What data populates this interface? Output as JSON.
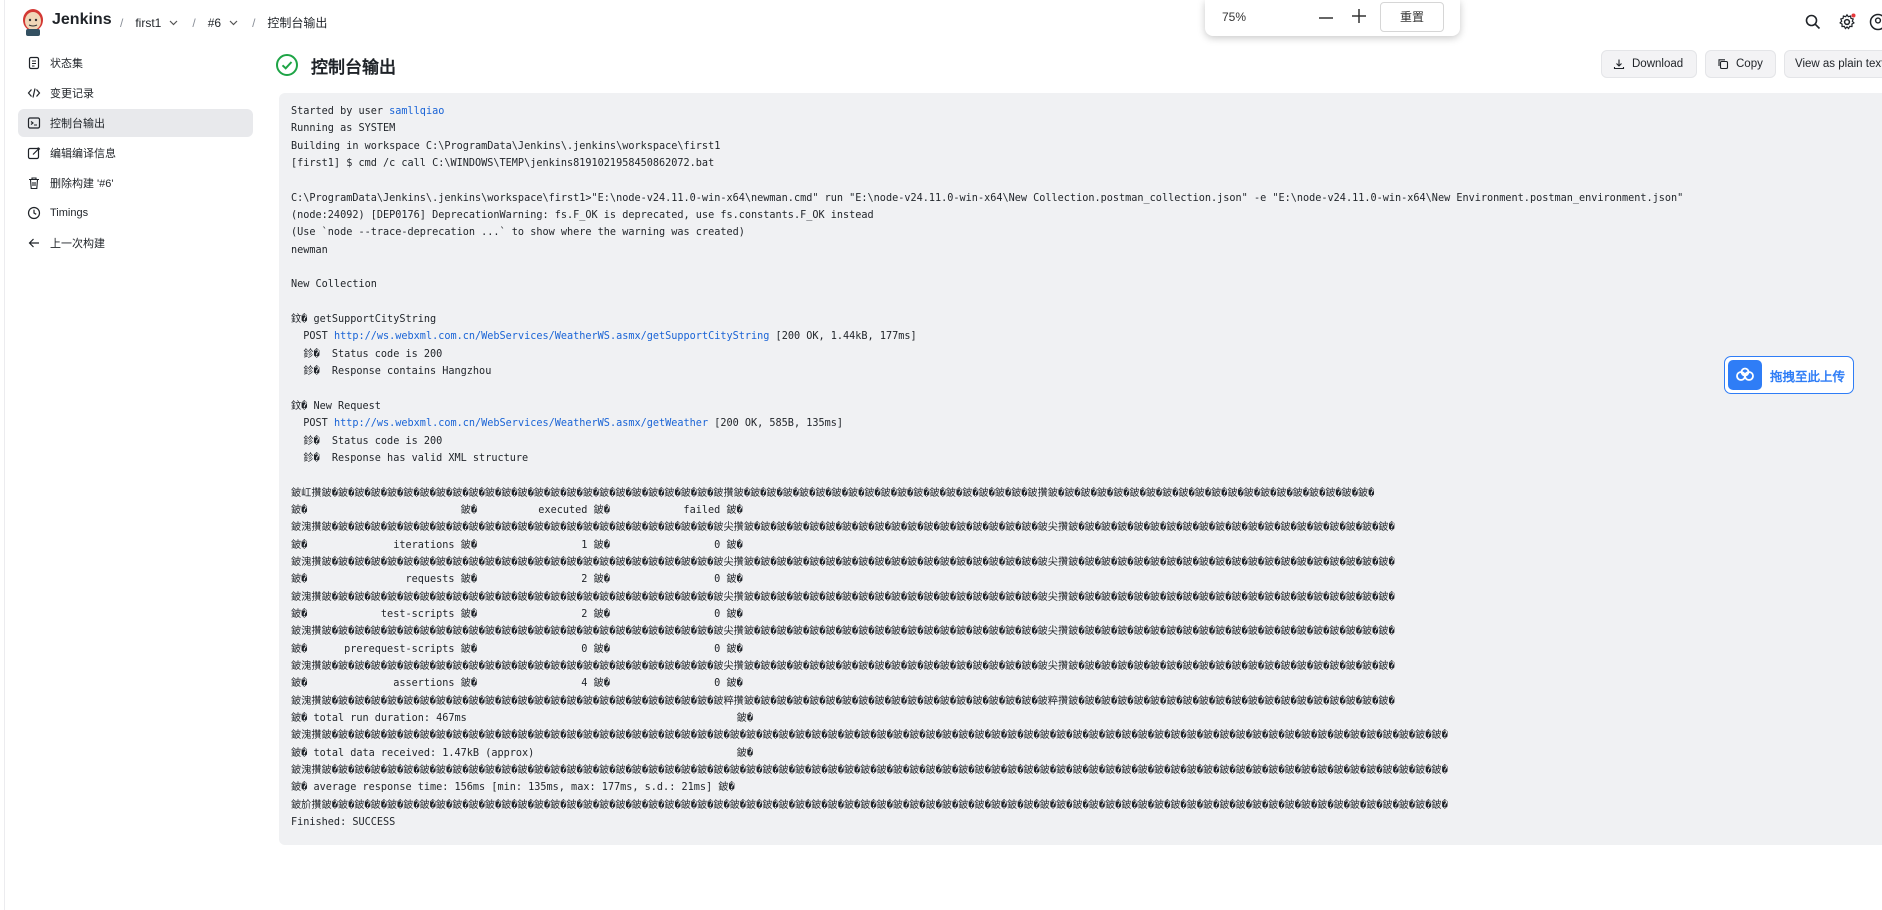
{
  "header": {
    "brand": "Jenkins",
    "breadcrumbs": [
      {
        "label": "first1",
        "has_dropdown": true
      },
      {
        "label": "#6",
        "has_dropdown": true
      },
      {
        "label": "控制台输出",
        "has_dropdown": false
      }
    ],
    "icons": [
      "search-icon",
      "settings-icon",
      "user-icon"
    ]
  },
  "zoom": {
    "level": "75%",
    "reset_label": "重置"
  },
  "sidebar": {
    "items": [
      {
        "label": "状态集",
        "icon": "document-icon",
        "active": false
      },
      {
        "label": "变更记录",
        "icon": "code-icon",
        "active": false
      },
      {
        "label": "控制台输出",
        "icon": "terminal-icon",
        "active": true
      },
      {
        "label": "编辑编译信息",
        "icon": "edit-icon",
        "active": false
      },
      {
        "label": "删除构建 '#6'",
        "icon": "trash-icon",
        "active": false
      },
      {
        "label": "Timings",
        "icon": "clock-icon",
        "active": false
      },
      {
        "label": "上一次构建",
        "icon": "arrow-left-icon",
        "active": false
      }
    ]
  },
  "main": {
    "title": "控制台输出",
    "status_color": "#1ea446",
    "actions": {
      "download": "Download",
      "copy": "Copy",
      "plain": "View as plain text"
    }
  },
  "console": {
    "l_started_prefix": "Started by user ",
    "l_started_user": "samllqiao",
    "l_running": "Running as SYSTEM",
    "l_building": "Building in workspace C:\\ProgramData\\Jenkins\\.jenkins\\workspace\\first1",
    "l_cmd": "[first1] $ cmd /c call C:\\WINDOWS\\TEMP\\jenkins8191021958450862072.bat",
    "l_blank1": "",
    "l_newman_cmd": "C:\\ProgramData\\Jenkins\\.jenkins\\workspace\\first1>\"E:\\node-v24.11.0-win-x64\\newman.cmd\" run \"E:\\node-v24.11.0-win-x64\\New Collection.postman_collection.json\" -e \"E:\\node-v24.11.0-win-x64\\New Environment.postman_environment.json\"",
    "l_deprecation": "(node:24092) [DEP0176] DeprecationWarning: fs.F_OK is deprecated, use fs.constants.F_OK instead",
    "l_trace": "(Use `node --trace-deprecation ...` to show where the warning was created)",
    "l_newman": "newman",
    "l_blank2": "",
    "l_collection": "New Collection",
    "l_blank3": "",
    "l_req1_name": "鈫� getSupportCityString",
    "l_req1_method": "  POST ",
    "l_req1_url": "http://ws.webxml.com.cn/WebServices/WeatherWS.asmx/getSupportCityString",
    "l_req1_stats": " [200 OK, 1.44kB, 177ms]",
    "l_req1_a1": "  鉁�  Status code is 200",
    "l_req1_a2": "  鉁�  Response contains Hangzhou",
    "l_blank4": "",
    "l_req2_name": "鈫� New Request",
    "l_req2_method": "  POST ",
    "l_req2_url": "http://ws.webxml.com.cn/WebServices/WeatherWS.asmx/getWeather",
    "l_req2_stats": " [200 OK, 585B, 135ms]",
    "l_req2_a1": "  鉁�  Status code is 200",
    "l_req2_a2": "  鉁�  Response has valid XML structure",
    "l_blank5": "",
    "l_t01": "鈹屸攢鈹�鈹�鈹�鈹�鈹�鈹�鈹�鈹�鈹�鈹�鈹�鈹�鈹�鈹�鈹�鈹�鈹�鈹�鈹�鈹�鈹�鈹�鈹�鈹�鈹攢鈹�鈹�鈹�鈹�鈹�鈹�鈹�鈹�鈹�鈹�鈹�鈹�鈹�鈹�鈹�鈹�鈹�鈹�鈹攢鈹�鈹�鈹�鈹�鈹�鈹�鈹�鈹�鈹�鈹�鈹�鈹�鈹�鈹�鈹�鈹�鈹�鈹�鈹�鈹�",
    "l_t02": "鈹�                         鈹�          executed 鈹�            failed 鈹�",
    "l_t03": "鈹溾攢鈹�鈹�鈹�鈹�鈹�鈹�鈹�鈹�鈹�鈹�鈹�鈹�鈹�鈹�鈹�鈹�鈹�鈹�鈹�鈹�鈹�鈹�鈹�鈹�鈹尖攢鈹�鈹�鈹�鈹�鈹�鈹�鈹�鈹�鈹�鈹�鈹�鈹�鈹�鈹�鈹�鈹�鈹�鈹�鈹尖攢鈹�鈹�鈹�鈹�鈹�鈹�鈹�鈹�鈹�鈹�鈹�鈹�鈹�鈹�鈹�鈹�鈹�鈹�鈹�鈹�",
    "l_t04": "鈹�              iterations 鈹�                 1 鈹�                 0 鈹�",
    "l_t05": "鈹溾攢鈹�鈹�鈹�鈹�鈹�鈹�鈹�鈹�鈹�鈹�鈹�鈹�鈹�鈹�鈹�鈹�鈹�鈹�鈹�鈹�鈹�鈹�鈹�鈹�鈹尖攢鈹�鈹�鈹�鈹�鈹�鈹�鈹�鈹�鈹�鈹�鈹�鈹�鈹�鈹�鈹�鈹�鈹�鈹�鈹尖攢鈹�鈹�鈹�鈹�鈹�鈹�鈹�鈹�鈹�鈹�鈹�鈹�鈹�鈹�鈹�鈹�鈹�鈹�鈹�鈹�",
    "l_t06": "鈹�                requests 鈹�                 2 鈹�                 0 鈹�",
    "l_t07": "鈹溾攢鈹�鈹�鈹�鈹�鈹�鈹�鈹�鈹�鈹�鈹�鈹�鈹�鈹�鈹�鈹�鈹�鈹�鈹�鈹�鈹�鈹�鈹�鈹�鈹�鈹尖攢鈹�鈹�鈹�鈹�鈹�鈹�鈹�鈹�鈹�鈹�鈹�鈹�鈹�鈹�鈹�鈹�鈹�鈹�鈹尖攢鈹�鈹�鈹�鈹�鈹�鈹�鈹�鈹�鈹�鈹�鈹�鈹�鈹�鈹�鈹�鈹�鈹�鈹�鈹�鈹�",
    "l_t08": "鈹�            test-scripts 鈹�                 2 鈹�                 0 鈹�",
    "l_t09": "鈹溾攢鈹�鈹�鈹�鈹�鈹�鈹�鈹�鈹�鈹�鈹�鈹�鈹�鈹�鈹�鈹�鈹�鈹�鈹�鈹�鈹�鈹�鈹�鈹�鈹�鈹尖攢鈹�鈹�鈹�鈹�鈹�鈹�鈹�鈹�鈹�鈹�鈹�鈹�鈹�鈹�鈹�鈹�鈹�鈹�鈹尖攢鈹�鈹�鈹�鈹�鈹�鈹�鈹�鈹�鈹�鈹�鈹�鈹�鈹�鈹�鈹�鈹�鈹�鈹�鈹�鈹�",
    "l_t10": "鈹�      prerequest-scripts 鈹�                 0 鈹�                 0 鈹�",
    "l_t11": "鈹溾攢鈹�鈹�鈹�鈹�鈹�鈹�鈹�鈹�鈹�鈹�鈹�鈹�鈹�鈹�鈹�鈹�鈹�鈹�鈹�鈹�鈹�鈹�鈹�鈹�鈹尖攢鈹�鈹�鈹�鈹�鈹�鈹�鈹�鈹�鈹�鈹�鈹�鈹�鈹�鈹�鈹�鈹�鈹�鈹�鈹尖攢鈹�鈹�鈹�鈹�鈹�鈹�鈹�鈹�鈹�鈹�鈹�鈹�鈹�鈹�鈹�鈹�鈹�鈹�鈹�鈹�",
    "l_t12": "鈹�              assertions 鈹�                 4 鈹�                 0 鈹�",
    "l_t13": "鈹溾攢鈹�鈹�鈹�鈹�鈹�鈹�鈹�鈹�鈹�鈹�鈹�鈹�鈹�鈹�鈹�鈹�鈹�鈹�鈹�鈹�鈹�鈹�鈹�鈹�鈹粹攢鈹�鈹�鈹�鈹�鈹�鈹�鈹�鈹�鈹�鈹�鈹�鈹�鈹�鈹�鈹�鈹�鈹�鈹�鈹粹攢鈹�鈹�鈹�鈹�鈹�鈹�鈹�鈹�鈹�鈹�鈹�鈹�鈹�鈹�鈹�鈹�鈹�鈹�鈹�鈹�",
    "l_t14": "鈹� total run duration: 467ms                                            鈹�",
    "l_t15": "鈹溾攢鈹�鈹�鈹�鈹�鈹�鈹�鈹�鈹�鈹�鈹�鈹�鈹�鈹�鈹�鈹�鈹�鈹�鈹�鈹�鈹�鈹�鈹�鈹�鈹�鈹�鈹�鈹�鈹�鈹�鈹�鈹�鈹�鈹�鈹�鈹�鈹�鈹�鈹�鈹�鈹�鈹�鈹�鈹�鈹�鈹�鈹�鈹�鈹�鈹�鈹�鈹�鈹�鈹�鈹�鈹�鈹�鈹�鈹�鈹�鈹�鈹�鈹�鈹�鈹�鈹�鈹�鈹�鈹�鈹�",
    "l_t16": "鈹� total data received: 1.47kB (approx)                                 鈹�",
    "l_t17": "鈹溾攢鈹�鈹�鈹�鈹�鈹�鈹�鈹�鈹�鈹�鈹�鈹�鈹�鈹�鈹�鈹�鈹�鈹�鈹�鈹�鈹�鈹�鈹�鈹�鈹�鈹�鈹�鈹�鈹�鈹�鈹�鈹�鈹�鈹�鈹�鈹�鈹�鈹�鈹�鈹�鈹�鈹�鈹�鈹�鈹�鈹�鈹�鈹�鈹�鈹�鈹�鈹�鈹�鈹�鈹�鈹�鈹�鈹�鈹�鈹�鈹�鈹�鈹�鈹�鈹�鈹�鈹�鈹�鈹�鈹�",
    "l_t18": "鈹� average response time: 156ms [min: 135ms, max: 177ms, s.d.: 21ms] 鈹�",
    "l_t19": "鈹斺攢鈹�鈹�鈹�鈹�鈹�鈹�鈹�鈹�鈹�鈹�鈹�鈹�鈹�鈹�鈹�鈹�鈹�鈹�鈹�鈹�鈹�鈹�鈹�鈹�鈹�鈹�鈹�鈹�鈹�鈹�鈹�鈹�鈹�鈹�鈹�鈹�鈹�鈹�鈹�鈹�鈹�鈹�鈹�鈹�鈹�鈹�鈹�鈹�鈹�鈹�鈹�鈹�鈹�鈹�鈹�鈹�鈹�鈹�鈹�鈹�鈹�鈹�鈹�鈹�鈹�鈹�鈹�鈹�鈹�",
    "l_finished": "Finished: SUCCESS"
  },
  "upload": {
    "label": "拖拽至此上传",
    "color": "#2f7df6"
  }
}
